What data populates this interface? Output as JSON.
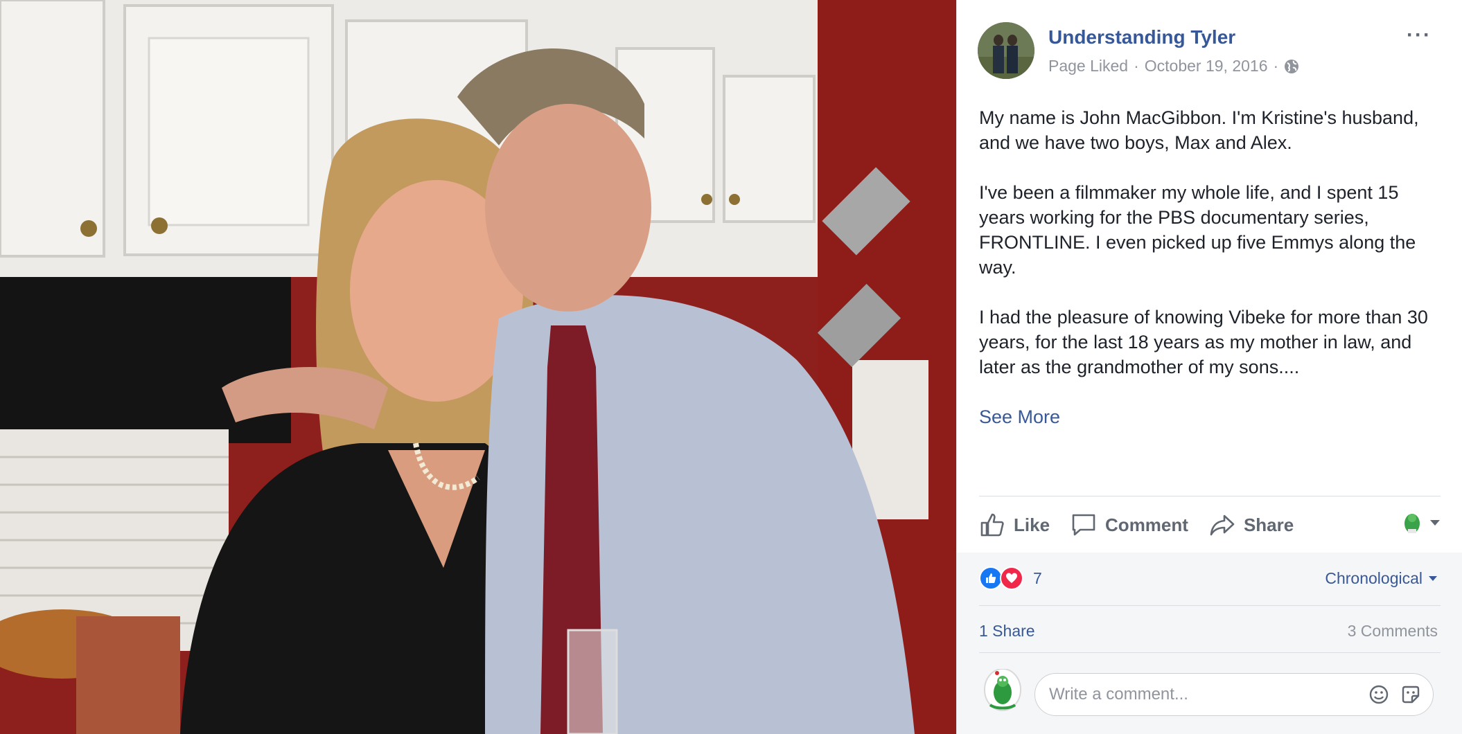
{
  "post": {
    "author": "Understanding Tyler",
    "status": "Page Liked",
    "separator": "·",
    "date": "October 19, 2016",
    "more_label": "···",
    "paragraphs": [
      "My name is John MacGibbon. I'm Kristine's husband, and we have two boys, Max and Alex.",
      "I've been a filmmaker my whole life, and I spent 15 years working for the PBS documentary series, FRONTLINE. I even picked up five Emmys along the way.",
      "I had the pleasure of knowing Vibeke for more than 30 years, for the last 18 years as my mother in law, and later as the grandmother of my sons...."
    ],
    "see_more": "See More"
  },
  "actions": {
    "like": "Like",
    "comment": "Comment",
    "share": "Share"
  },
  "stats": {
    "reaction_count": "7",
    "sort_label": "Chronological",
    "shares": "1 Share",
    "comments": "3 Comments"
  },
  "composer": {
    "placeholder": "Write a comment..."
  },
  "colors": {
    "link": "#385898",
    "like_blue": "#1877f2",
    "love_red": "#f0284a",
    "panel_bg": "#ffffff",
    "lower_bg": "#f5f6f7"
  },
  "icons": [
    "like-icon",
    "comment-icon",
    "share-icon",
    "globe-icon",
    "emoji-icon",
    "sticker-icon",
    "chevron-down-icon"
  ]
}
